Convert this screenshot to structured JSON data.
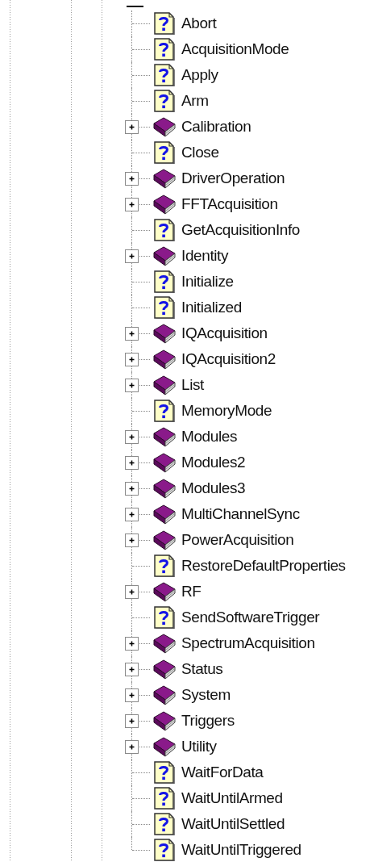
{
  "tree": {
    "items": [
      {
        "label": "Abort",
        "kind": "page"
      },
      {
        "label": "AcquisitionMode",
        "kind": "page"
      },
      {
        "label": "Apply",
        "kind": "page"
      },
      {
        "label": "Arm",
        "kind": "page"
      },
      {
        "label": "Calibration",
        "kind": "book",
        "expanded": false
      },
      {
        "label": "Close",
        "kind": "page"
      },
      {
        "label": "DriverOperation",
        "kind": "book",
        "expanded": false
      },
      {
        "label": "FFTAcquisition",
        "kind": "book",
        "expanded": false
      },
      {
        "label": "GetAcquisitionInfo",
        "kind": "page"
      },
      {
        "label": "Identity",
        "kind": "book",
        "expanded": false
      },
      {
        "label": "Initialize",
        "kind": "page"
      },
      {
        "label": "Initialized",
        "kind": "page"
      },
      {
        "label": "IQAcquisition",
        "kind": "book",
        "expanded": false
      },
      {
        "label": "IQAcquisition2",
        "kind": "book",
        "expanded": false
      },
      {
        "label": "List",
        "kind": "book",
        "expanded": false
      },
      {
        "label": "MemoryMode",
        "kind": "page"
      },
      {
        "label": "Modules",
        "kind": "book",
        "expanded": false
      },
      {
        "label": "Modules2",
        "kind": "book",
        "expanded": false
      },
      {
        "label": "Modules3",
        "kind": "book",
        "expanded": false
      },
      {
        "label": "MultiChannelSync",
        "kind": "book",
        "expanded": false
      },
      {
        "label": "PowerAcquisition",
        "kind": "book",
        "expanded": false
      },
      {
        "label": "RestoreDefaultProperties",
        "kind": "page"
      },
      {
        "label": "RF",
        "kind": "book",
        "expanded": false
      },
      {
        "label": "SendSoftwareTrigger",
        "kind": "page"
      },
      {
        "label": "SpectrumAcquisition",
        "kind": "book",
        "expanded": false
      },
      {
        "label": "Status",
        "kind": "book",
        "expanded": false
      },
      {
        "label": "System",
        "kind": "book",
        "expanded": false
      },
      {
        "label": "Triggers",
        "kind": "book",
        "expanded": false
      },
      {
        "label": "Utility",
        "kind": "book",
        "expanded": false
      },
      {
        "label": "WaitForData",
        "kind": "page"
      },
      {
        "label": "WaitUntilArmed",
        "kind": "page"
      },
      {
        "label": "WaitUntilSettled",
        "kind": "page"
      },
      {
        "label": "WaitUntilTriggered",
        "kind": "page"
      }
    ]
  }
}
